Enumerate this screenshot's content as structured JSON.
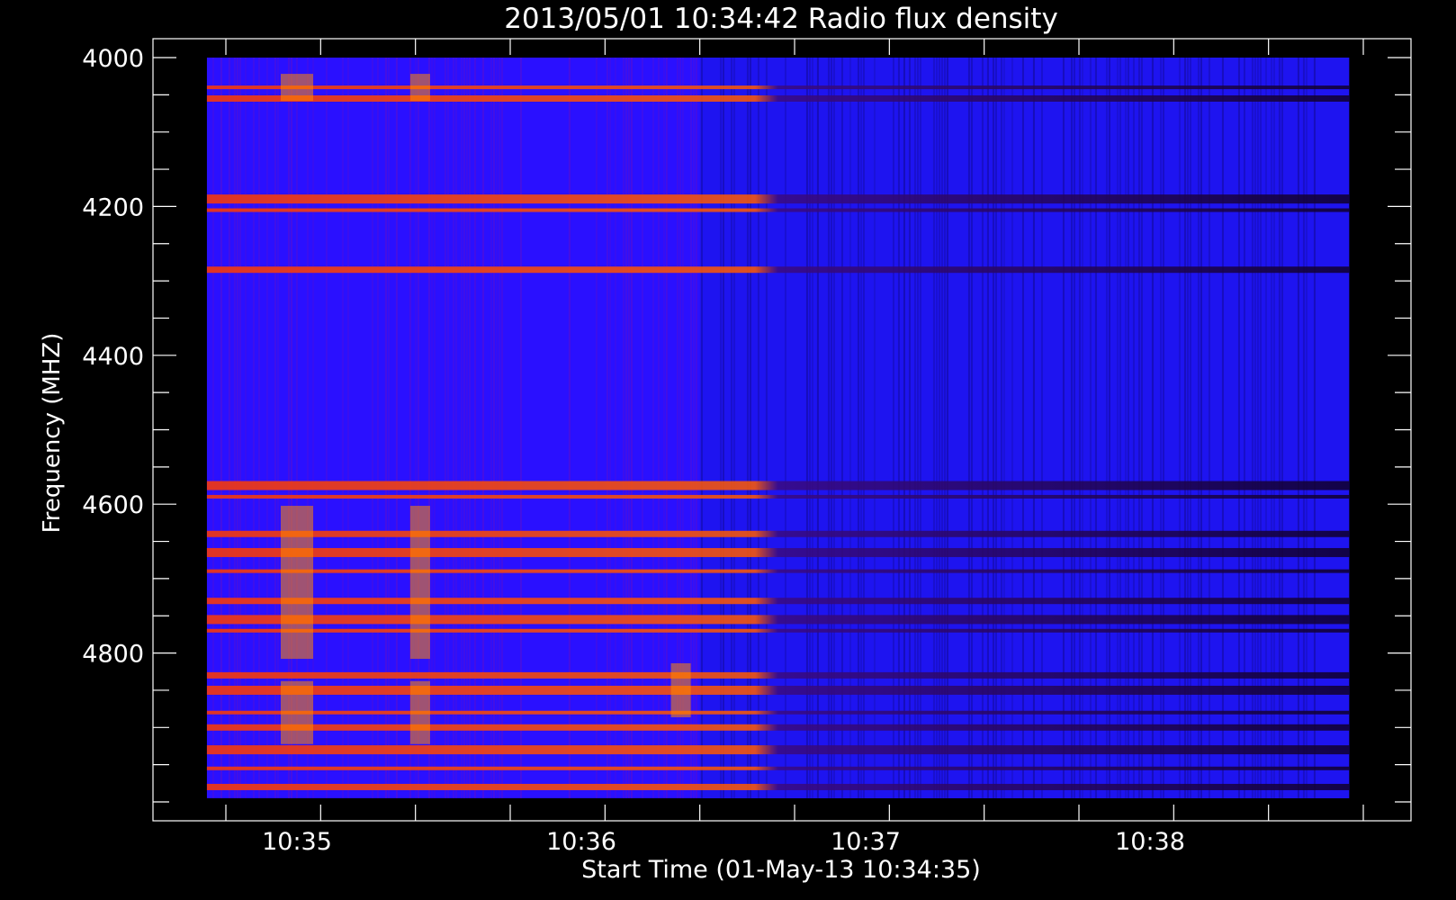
{
  "chart_data": {
    "type": "heatmap",
    "title": "2013/05/01 10:34:42 Radio flux density",
    "xlabel": "Start Time (01-May-13 10:34:35)",
    "ylabel": "Frequency (MHZ)",
    "x_start": "10:34:35",
    "x_ticks": [
      "10:35",
      "10:36",
      "10:37",
      "10:38"
    ],
    "y_ticks": [
      4000,
      4200,
      4400,
      4600,
      4800
    ],
    "ylim": [
      4000,
      5000
    ],
    "y_inverted": true,
    "colormap": [
      "#000000",
      "#2a00ff",
      "#ff2200",
      "#ffa000",
      "#ffff60"
    ],
    "background": "#000000",
    "axis_color": "#ffffff",
    "data_x_range": [
      "10:34:41",
      "10:38:42"
    ],
    "data_y_range": [
      4000,
      4995
    ],
    "emission_bands_mhz": [
      4040,
      4055,
      4190,
      4205,
      4285,
      4575,
      4590,
      4640,
      4665,
      4690,
      4730,
      4755,
      4770,
      4830,
      4850,
      4880,
      4900,
      4930,
      4955,
      4980
    ],
    "bright_before": "10:36:25"
  }
}
